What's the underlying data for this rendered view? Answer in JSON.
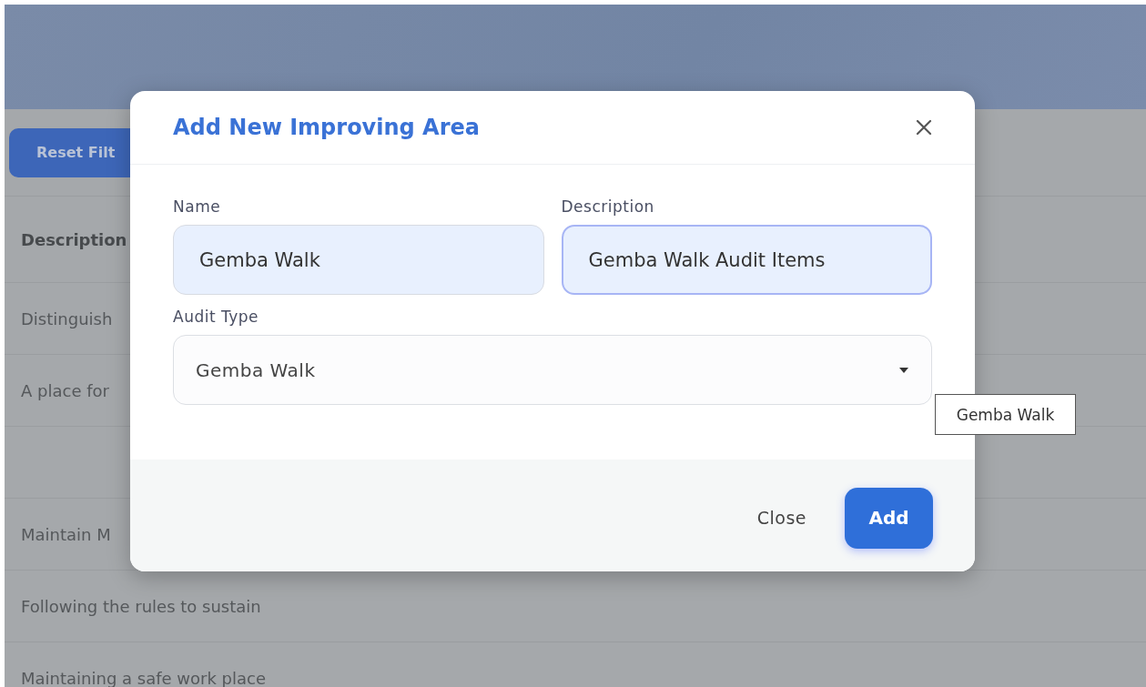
{
  "background": {
    "reset_button": "Reset Filt",
    "table": {
      "columns": [
        "Description"
      ],
      "rows": [
        {
          "cell": "Distinguish"
        },
        {
          "cell": "A place for"
        },
        {
          "cell": ""
        },
        {
          "cell": "Maintain M"
        },
        {
          "cell": "Following the rules to sustain"
        },
        {
          "cell": "Maintaining a safe work place"
        }
      ]
    }
  },
  "dialog": {
    "title": "Add New Improving Area",
    "fields": [
      {
        "label": "Name",
        "value": "Gemba Walk",
        "focused": false
      },
      {
        "label": "Description",
        "value": "Gemba Walk Audit Items",
        "focused": true
      }
    ],
    "select": {
      "label": "Audit Type",
      "value": "Gemba Walk"
    },
    "buttons": [
      {
        "label": "Close",
        "kind": "text"
      },
      {
        "label": "Add",
        "kind": "primary"
      }
    ]
  },
  "tooltip": "Gemba Walk"
}
